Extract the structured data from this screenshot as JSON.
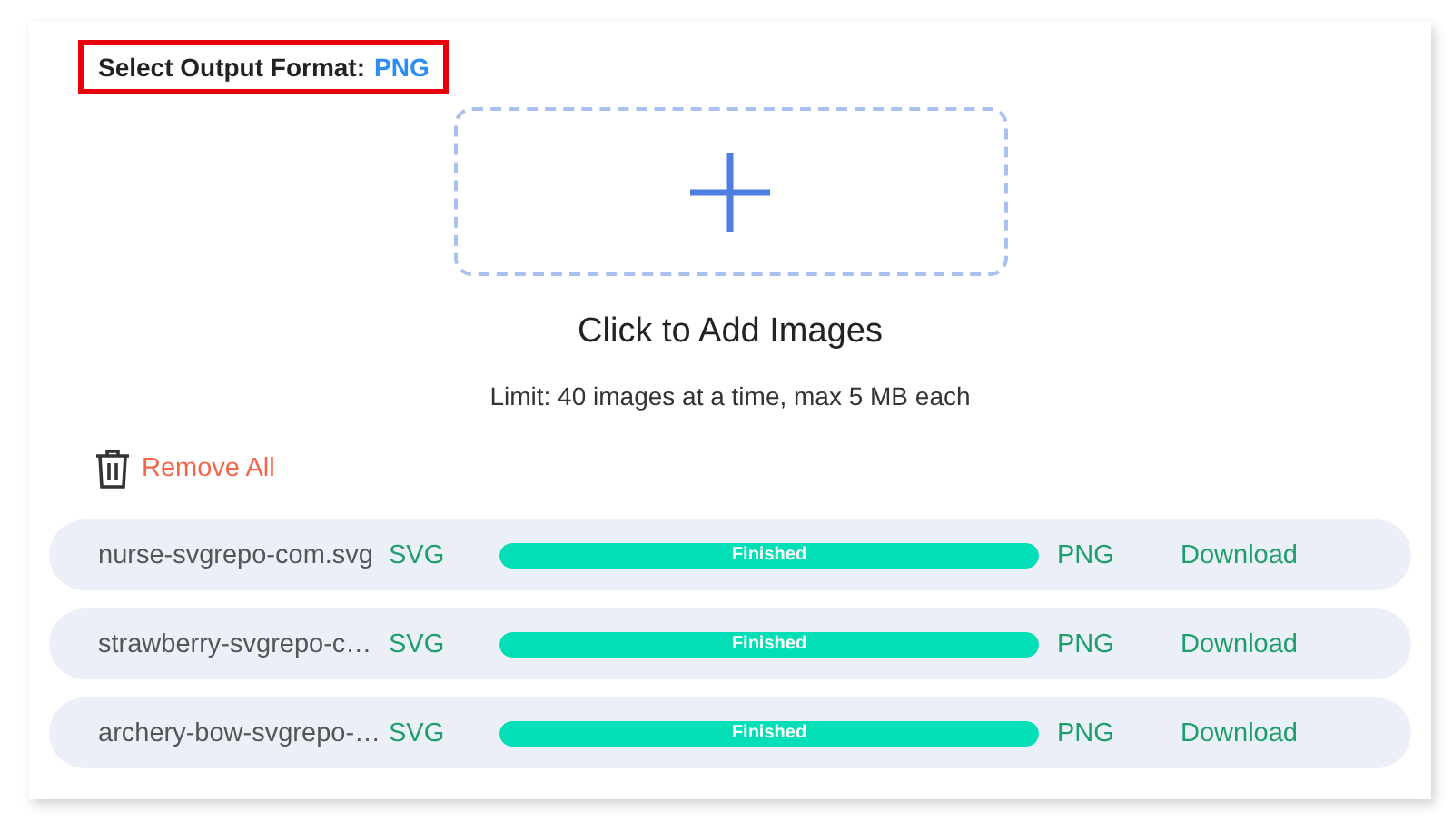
{
  "output_format": {
    "label": "Select Output Format:",
    "value": "PNG"
  },
  "upload": {
    "title": "Click to Add Images",
    "limit": "Limit: 40 images at a time, max 5 MB each"
  },
  "remove_all": "Remove All",
  "files": [
    {
      "name": "nurse-svgrepo-com.svg",
      "from": "SVG",
      "status": "Finished",
      "level": 1,
      "to": "PNG",
      "action": "Download"
    },
    {
      "name": "strawberry-svgrepo-c…",
      "from": "SVG",
      "status": "Finished",
      "level": 1,
      "to": "PNG",
      "action": "Download"
    },
    {
      "name": "archery-bow-svgrepo-…",
      "from": "SVG",
      "status": "Finished",
      "level": 1,
      "to": "PNG",
      "action": "Download"
    }
  ]
}
